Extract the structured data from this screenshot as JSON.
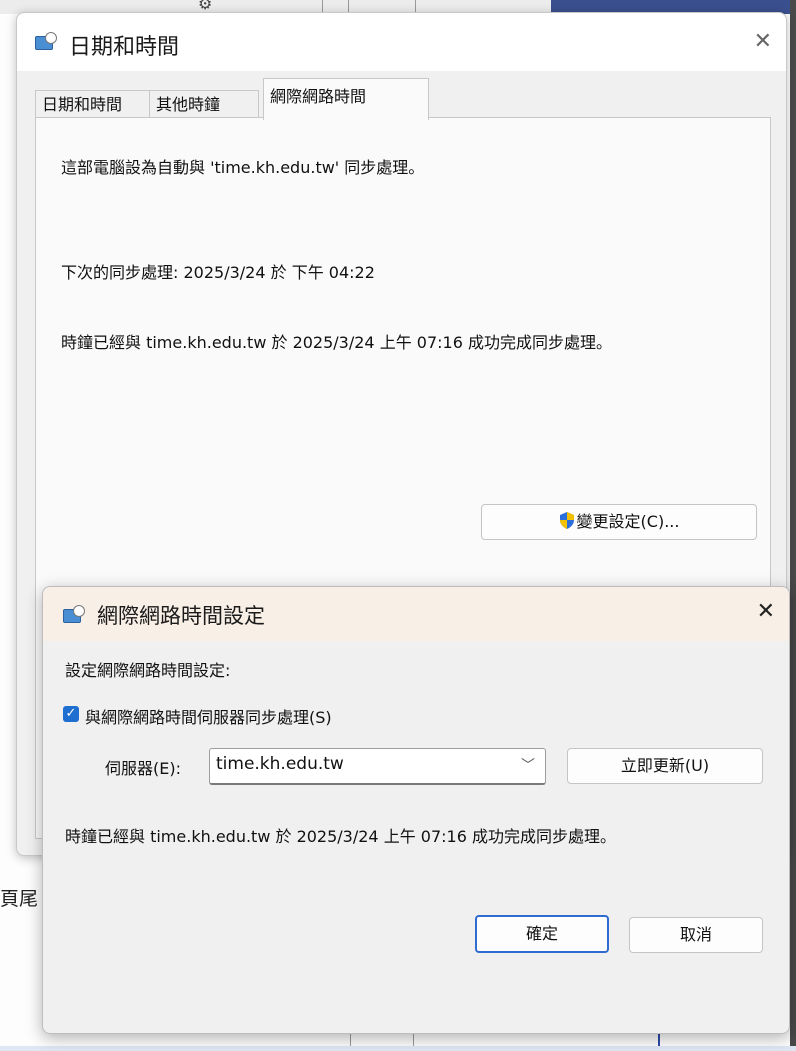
{
  "main_dialog": {
    "title": "日期和時間",
    "tabs": [
      "日期和時間",
      "其他時鐘",
      "網際網路時間"
    ],
    "active_tab": 2,
    "sync_info": "這部電腦設為自動與 'time.kh.edu.tw' 同步處理。",
    "next_sync": "下次的同步處理: 2025/3/24 於 下午 04:22",
    "last_sync": "時鐘已經與 time.kh.edu.tw 於 2025/3/24 上午 07:16 成功完成同步處理。",
    "change_settings_label": "變更設定(C)..."
  },
  "settings_dialog": {
    "title": "網際網路時間設定",
    "heading": "設定網際網路時間設定:",
    "sync_checkbox_label": "與網際網路時間伺服器同步處理(S)",
    "sync_checked": true,
    "server_label": "伺服器(E):",
    "server_value": "time.kh.edu.tw",
    "update_now_label": "立即更新(U)",
    "status": "時鐘已經與 time.kh.edu.tw 於 2025/3/24 上午 07:16 成功完成同步處理。",
    "ok_label": "確定",
    "cancel_label": "取消"
  },
  "background": {
    "partial_text": "頁尾"
  },
  "colors": {
    "accent": "#1f6fd1",
    "shield_blue": "#2a6fdb",
    "shield_yellow": "#f2c200",
    "settings_title_bg": "#f8efe6"
  }
}
